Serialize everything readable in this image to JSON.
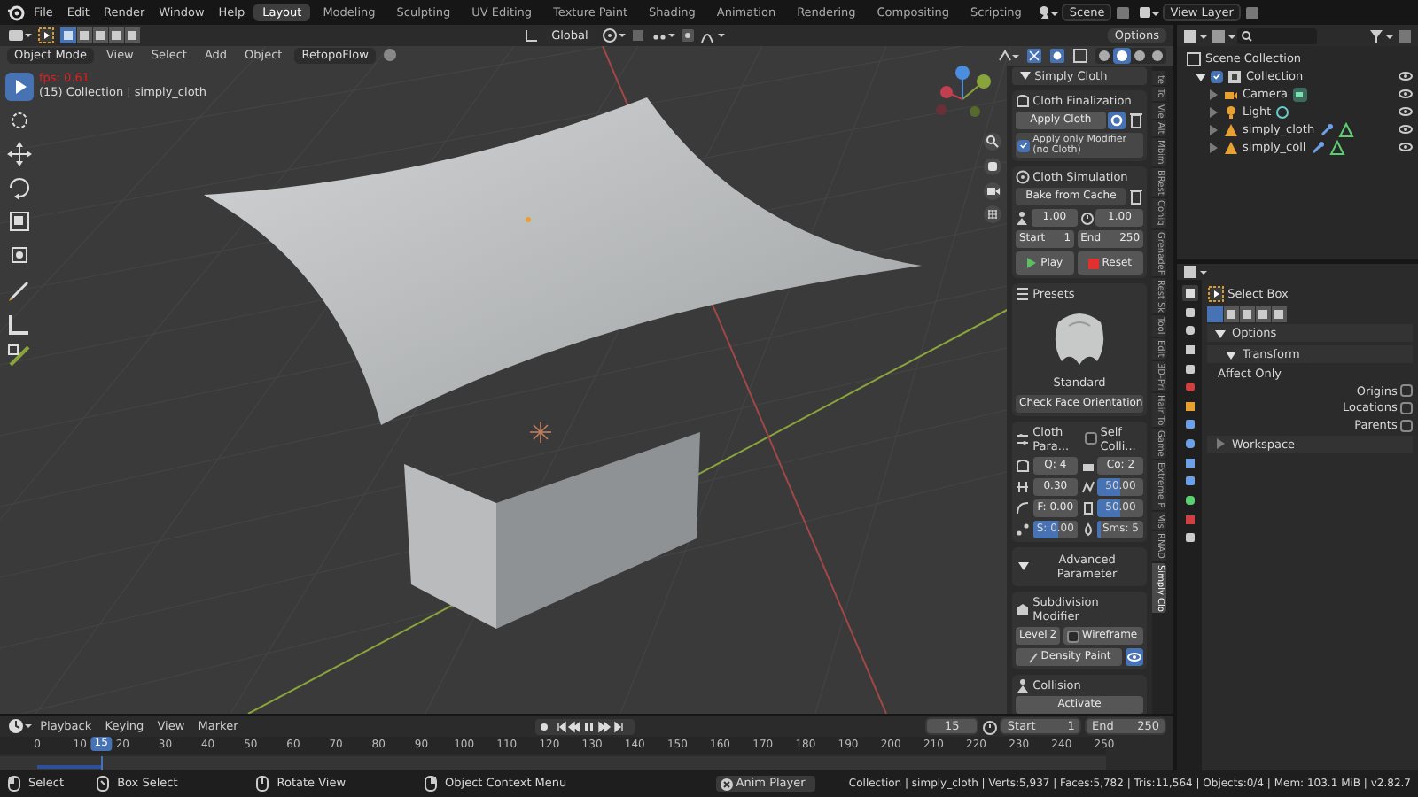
{
  "menu_bar": {
    "menus": [
      "File",
      "Edit",
      "Render",
      "Window",
      "Help"
    ],
    "workspaces": [
      {
        "label": "Layout",
        "selected": true
      },
      {
        "label": "Modeling",
        "selected": false
      },
      {
        "label": "Sculpting",
        "selected": false
      },
      {
        "label": "UV Editing",
        "selected": false
      },
      {
        "label": "Texture Paint",
        "selected": false
      },
      {
        "label": "Shading",
        "selected": false
      },
      {
        "label": "Animation",
        "selected": false
      },
      {
        "label": "Rendering",
        "selected": false
      },
      {
        "label": "Compositing",
        "selected": false
      },
      {
        "label": "Scripting",
        "selected": false
      }
    ],
    "scene": "Scene",
    "view_layer": "View Layer"
  },
  "tool_header": {
    "orientation": "Global",
    "options": "Options"
  },
  "viewport_header": {
    "mode": "Object Mode",
    "menus": [
      "View",
      "Select",
      "Add",
      "Object"
    ],
    "addon": "RetopoFlow"
  },
  "viewport": {
    "fps": "fps: 0.61",
    "info": "(15) Collection | simply_cloth"
  },
  "n_panel": {
    "title": "Simply Cloth",
    "finalization": {
      "title": "Cloth Finalization",
      "apply": "Apply Cloth",
      "only_modifier": {
        "label": "Apply only Modifier (no Cloth)",
        "checked": true
      }
    },
    "simulation": {
      "title": "Cloth Simulation",
      "bake": "Bake from Cache",
      "values": [
        "1.00",
        "1.00"
      ],
      "start": {
        "label": "Start",
        "value": "1"
      },
      "end": {
        "label": "End",
        "value": "250"
      },
      "play": "Play",
      "reset": "Reset"
    },
    "presets": {
      "title": "Presets",
      "preset": "Standard",
      "check": "Check Face Orientation"
    },
    "parameters": {
      "title": "Cloth Para...",
      "self_collision": {
        "label": "Self Colli...",
        "checked": false
      },
      "fields": [
        {
          "value": "Q: 4"
        },
        {
          "value": "Co: 2"
        },
        {
          "value": "0.30"
        },
        {
          "value": "50.00",
          "level": 0.5
        },
        {
          "value": "F: 0.00"
        },
        {
          "value": "50.00",
          "level": 0.5
        },
        {
          "value": "S: 0.00",
          "level": 0.55
        },
        {
          "value": "Sms: 5",
          "level": 0.08
        }
      ]
    },
    "advanced": "Advanced Parameter",
    "subdivision": {
      "title": "Subdivision Modifier",
      "subdiv_level": {
        "label": "Level",
        "value": "2"
      },
      "wireframe": {
        "label": "Wireframe",
        "checked": false
      },
      "density": "Density Paint"
    },
    "collision": {
      "title": "Collision",
      "activate": "Activate"
    }
  },
  "sidebar_tabs": [
    {
      "label": "Ite",
      "selected": false
    },
    {
      "label": "To",
      "selected": false
    },
    {
      "label": "Vie",
      "selected": false
    },
    {
      "label": "Alt",
      "selected": false
    },
    {
      "label": "Mbim",
      "selected": false
    },
    {
      "label": "BRest",
      "selected": false
    },
    {
      "label": "Conig",
      "selected": false
    },
    {
      "label": "GrenadeF",
      "selected": false
    },
    {
      "label": "Rest Sk",
      "selected": false
    },
    {
      "label": "Tool",
      "selected": false
    },
    {
      "label": "Edit",
      "selected": false
    },
    {
      "label": "3D-Pri",
      "selected": false
    },
    {
      "label": "Hair To",
      "selected": false
    },
    {
      "label": "Game",
      "selected": false
    },
    {
      "label": "Extreme P",
      "selected": false
    },
    {
      "label": "Mis",
      "selected": false
    },
    {
      "label": "RNAD",
      "selected": false
    },
    {
      "label": "Simply Clo",
      "selected": true
    }
  ],
  "outliner": {
    "items": [
      {
        "label": "Scene Collection",
        "kind": "scene_collection",
        "children": [
          {
            "label": "Collection",
            "kind": "collection",
            "expanded": true,
            "checked": true,
            "children": [
              {
                "label": "Camera",
                "kind": "camera",
                "expanded": false
              },
              {
                "label": "Light",
                "kind": "light",
                "expanded": false
              },
              {
                "label": "simply_cloth",
                "kind": "mesh",
                "expanded": false
              },
              {
                "label": "simply_coll",
                "kind": "mesh",
                "expanded": false
              }
            ]
          }
        ]
      }
    ]
  },
  "properties": {
    "tool": "Select Box",
    "options": {
      "title": "Options",
      "expanded": true
    },
    "transform": {
      "title": "Transform",
      "expanded": true
    },
    "affect_only": "Affect Only",
    "checks": [
      {
        "label": "Origins",
        "checked": false
      },
      {
        "label": "Locations",
        "checked": false
      },
      {
        "label": "Parents",
        "checked": false
      }
    ],
    "workspace": {
      "title": "Workspace",
      "expanded": false
    }
  },
  "timeline": {
    "menus": [
      "Playback",
      "Keying",
      "View",
      "Marker"
    ],
    "frame": "15",
    "start": {
      "label": "Start",
      "value": "1"
    },
    "end": {
      "label": "End",
      "value": "250"
    },
    "ruler": [
      "0",
      "10",
      "20",
      "30",
      "40",
      "50",
      "60",
      "70",
      "80",
      "90",
      "100",
      "110",
      "120",
      "130",
      "140",
      "150",
      "160",
      "170",
      "180",
      "190",
      "200",
      "210",
      "220",
      "230",
      "240",
      "250"
    ],
    "current": "15"
  },
  "status_bar": {
    "hints": [
      {
        "label": "Select",
        "kind": "left"
      },
      {
        "label": "Box Select",
        "kind": "drag"
      },
      {
        "label": "Rotate View",
        "kind": "middle"
      },
      {
        "label": "Object Context Menu",
        "kind": "right"
      }
    ],
    "job": "Anim Player",
    "stats": "Collection | simply_cloth | Verts:5,937 | Faces:5,782 | Tris:11,564 | Objects:0/4 | Mem: 103.1 MiB | v2.82.7"
  }
}
